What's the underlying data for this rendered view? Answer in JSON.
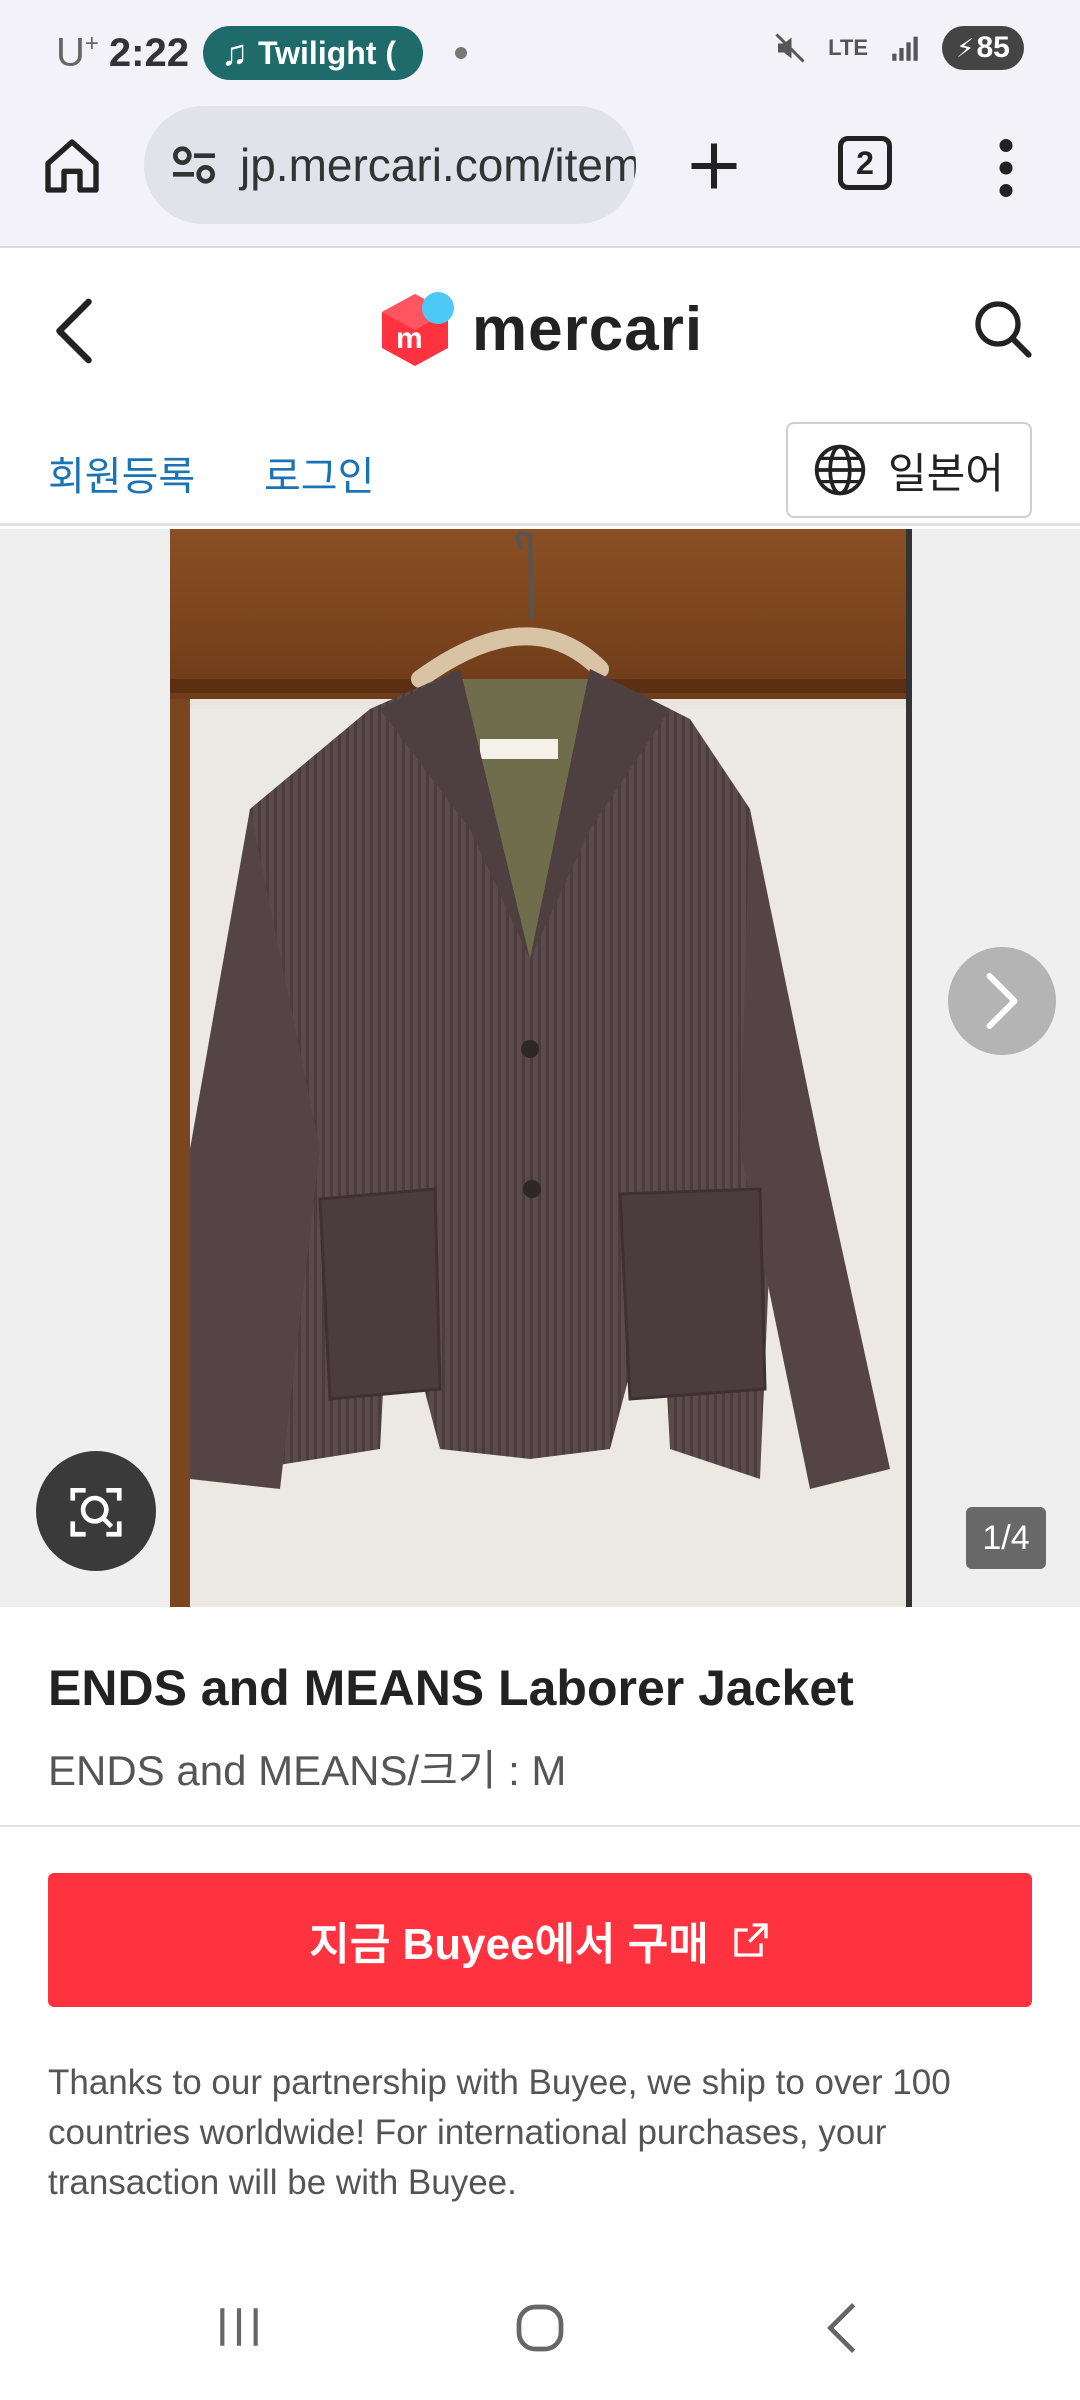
{
  "status_bar": {
    "carrier": "U",
    "carrier_sup": "+",
    "time": "2:22",
    "media_pill": "Twilight (",
    "network": "LTE",
    "battery": "85"
  },
  "browser": {
    "url": "jp.mercari.com/item/",
    "tab_count": "2"
  },
  "site": {
    "logo_text": "mercari",
    "logo_mark": "m",
    "register_link": "회원등록",
    "login_link": "로그인",
    "language_label": "일본어"
  },
  "gallery": {
    "counter": "1/4",
    "current_image": 1,
    "total_images": 4
  },
  "product": {
    "title": "ENDS and MEANS Laborer Jacket",
    "subtitle": "ENDS and MEANS/크기 : M",
    "buy_button": "지금 Buyee에서 구매",
    "partner_note": "Thanks to our partnership with Buyee, we ship to over 100 countries worldwide! For international purchases, your transaction will be with Buyee."
  },
  "colors": {
    "accent_red": "#ff333f",
    "link_blue": "#1a73b5",
    "media_pill": "#1f6b6b"
  },
  "icons": [
    "home-icon",
    "site-settings-icon",
    "plus-icon",
    "tabs-icon",
    "more-vert-icon",
    "back-arrow-icon",
    "search-icon",
    "globe-icon",
    "chevron-right-icon",
    "lens-search-icon",
    "external-link-icon",
    "recent-apps-icon",
    "nav-home-icon",
    "nav-back-icon"
  ]
}
